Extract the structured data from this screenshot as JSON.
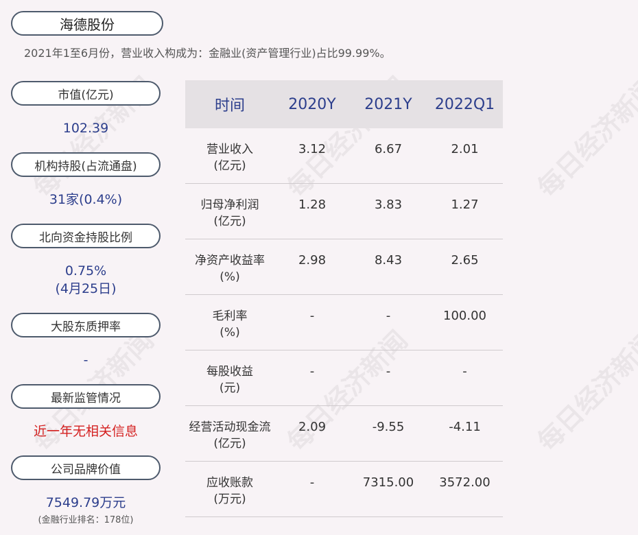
{
  "company": "海德股份",
  "summary": "2021年1至6月份，营业收入构成为：金融业(资产管理行业)占比99.99%。",
  "sidebar": [
    {
      "label": "市值(亿元)",
      "value": "102.39"
    },
    {
      "label": "机构持股(占流通盘)",
      "value": "31家(0.4%)"
    },
    {
      "label": "北向资金持股比例",
      "value": "0.75%",
      "value2": "(4月25日)"
    },
    {
      "label": "大股东质押率",
      "value": "-"
    },
    {
      "label": "最新监管情况",
      "value": "近一年无相关信息"
    },
    {
      "label": "公司品牌价值",
      "value": "7549.79万元",
      "sub": "(金融行业排名：178位)"
    }
  ],
  "table": {
    "headers": [
      "时间",
      "2020Y",
      "2021Y",
      "2022Q1"
    ],
    "rows": [
      {
        "name": "营业收入",
        "unit": "(亿元)",
        "values": [
          "3.12",
          "6.67",
          "2.01"
        ]
      },
      {
        "name": "归母净利润",
        "unit": "(亿元)",
        "values": [
          "1.28",
          "3.83",
          "1.27"
        ]
      },
      {
        "name": "净资产收益率",
        "unit": "(%)",
        "values": [
          "2.98",
          "8.43",
          "2.65"
        ]
      },
      {
        "name": "毛利率",
        "unit": "(%)",
        "values": [
          "-",
          "-",
          "100.00"
        ]
      },
      {
        "name": "每股收益",
        "unit": "(元)",
        "values": [
          "-",
          "-",
          "-"
        ]
      },
      {
        "name": "经营活动现金流",
        "unit": "(亿元)",
        "values": [
          "2.09",
          "-9.55",
          "-4.11"
        ]
      },
      {
        "name": "应收账款",
        "unit": "(万元)",
        "values": [
          "-",
          "7315.00",
          "3572.00"
        ]
      }
    ]
  },
  "watermark": "每日经济新闻",
  "colors": {
    "accent": "#2c3e8c",
    "alert": "#d42020",
    "background": "#f8f3f6",
    "header_bg": "#e5e1e4"
  }
}
